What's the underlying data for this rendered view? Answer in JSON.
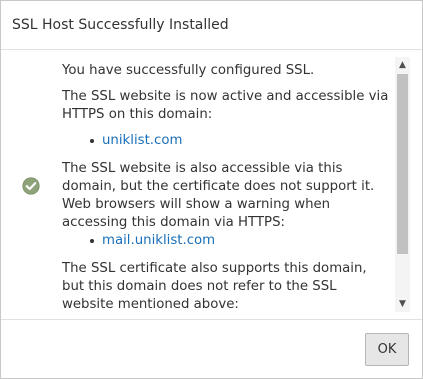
{
  "dialog": {
    "title": "SSL Host Successfully Installed"
  },
  "body": {
    "icon": "check-circle-icon",
    "intro": "You have successfully configured SSL.",
    "active_text": "The SSL website is now active and accessible via HTTPS on this domain:",
    "active_domains": [
      "uniklist.com"
    ],
    "also_text": "The SSL website is also accessible via this domain, but the certificate does not support it. Web browsers will show a warning when accessing this domain via HTTPS:",
    "also_domains": [
      "mail.uniklist.com"
    ],
    "supports_text": "The SSL certificate also supports this domain, but this domain does not refer to the SSL website mentioned above:"
  },
  "footer": {
    "ok_label": "OK"
  },
  "colors": {
    "link": "#1a6fb8",
    "success_icon": "#8fa37a",
    "button_bg": "#e6e6e6"
  }
}
